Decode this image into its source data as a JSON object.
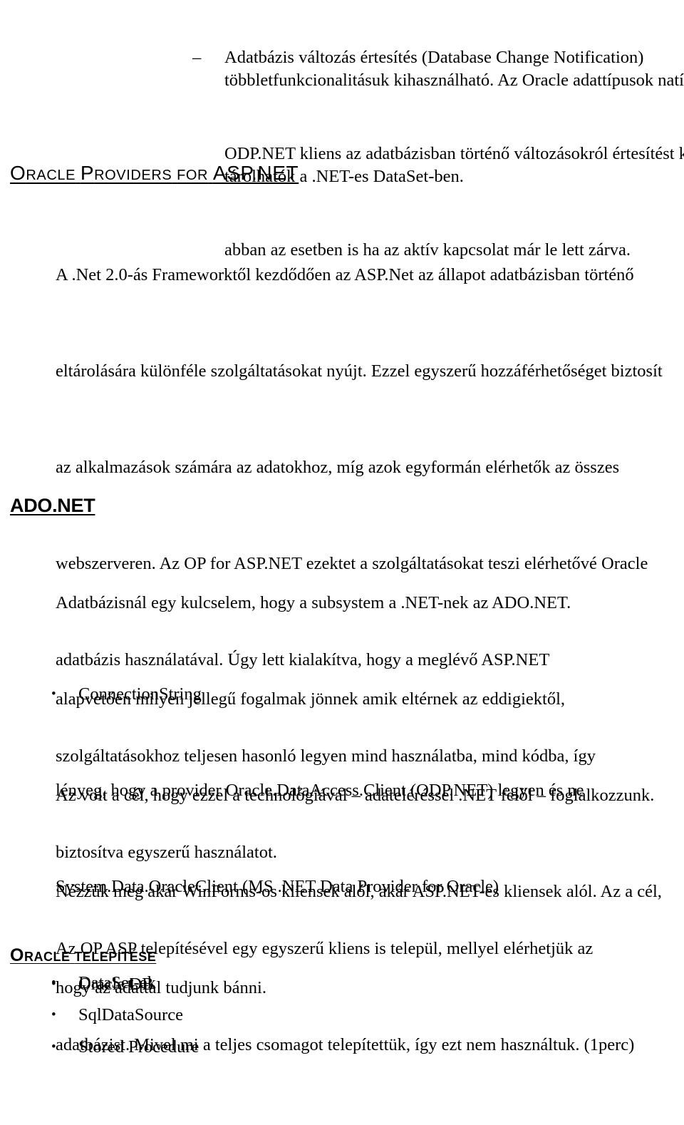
{
  "document": {
    "language": "hu",
    "page_background": "#ffffff",
    "text_color": "#000000"
  },
  "top_continuation": {
    "lines": [
      "többletfunkcionalitásuk kihasználható. Az Oracle adattípusok natívan",
      "tárolhatók a .NET-es DataSet-ben."
    ]
  },
  "dash_item": {
    "marker": "–",
    "text": "Adatbázis változás értesítés (Database Change Notification)",
    "sub_lines": [
      "ODP.NET kliens az adatbázisban történő változásokról értesítést kap még",
      "abban az esetben is ha az aktív kapcsolat már le lett zárva."
    ]
  },
  "heading_oracle_providers": {
    "first_letter": "O",
    "word_rest": "racle",
    "second_letter": "P",
    "second_rest": "roviders",
    "for_word": "for",
    "emphasis": "ASP.NET",
    "full_text": "ORACLE PROVIDERS FOR ASP.NET"
  },
  "section_oracle_providers": {
    "lines": [
      "A .Net 2.0-ás Frameworktől kezdődően az ASP.Net az állapot adatbázisban történő",
      "eltárolására különféle szolgáltatásokat nyújt. Ezzel egyszerű hozzáférhetőséget biztosít",
      "az alkalmazások számára az adatokhoz, míg azok egyformán elérhetők az összes",
      "webszerveren. Az OP for ASP.NET ezektet a szolgáltatásokat teszi elérhetővé Oracle",
      "adatbázis használatával. Úgy lett kialakítva, hogy a meglévő ASP.NET",
      "szolgáltatásokhoz teljesen hasonló legyen mind használatba, mind kódba, így",
      "biztosítva egyszerű használatot.",
      "Az OP.ASP telepítésével egy egyszerű kliens is települ, mellyel elérhetjük az",
      "adatbázist. Mivel mi a teljes csomagot telepítettük, így ezt nem használtuk. (1perc)"
    ]
  },
  "heading_ado_net": {
    "text": "ADO.NET"
  },
  "section_ado_net": {
    "lines": [
      "Adatbázisnál egy kulcselem, hogy a subsystem a .NET-nek az ADO.NET.",
      "alapvetően milyen jellegű fogalmak jönnek amik eltérnek az eddigiektől,",
      "Az volt a cél, hogy ezzel a technológiával – adateléréssel .NET felől – foglalkozzunk.",
      "Nézzük meg akár WinForms-os kliensek alól, akár ASP.NET-es kliensek alól. Az a cél,",
      "hogy az adattal tudjunk bánni."
    ],
    "bullets": [
      {
        "marker": "•",
        "text": "ConnectionString",
        "sub_lines": [
          "lényeg, hogy a provider Oracle.DataAccess.Client (ODP.NET) legyen és ne",
          "System.Data.OracleClient (MS .NET Data Provider for Oracle)"
        ]
      },
      {
        "marker": "•",
        "text": "DataSet-ek",
        "sub_lines": []
      },
      {
        "marker": "•",
        "text": "SqlDataSource",
        "sub_lines": []
      },
      {
        "marker": "•",
        "text": "Stored Procedure",
        "sub_lines": []
      }
    ]
  },
  "heading_oracle_telepitese": {
    "first_letter": "O",
    "word_rest": "racle",
    "second_word": "telepítése",
    "full_text": "ORACLE TELEPÍTÉSE"
  },
  "section_oracle_telepitese": {
    "bullets": [
      {
        "marker": "•",
        "text": "Oracle DB"
      }
    ]
  }
}
